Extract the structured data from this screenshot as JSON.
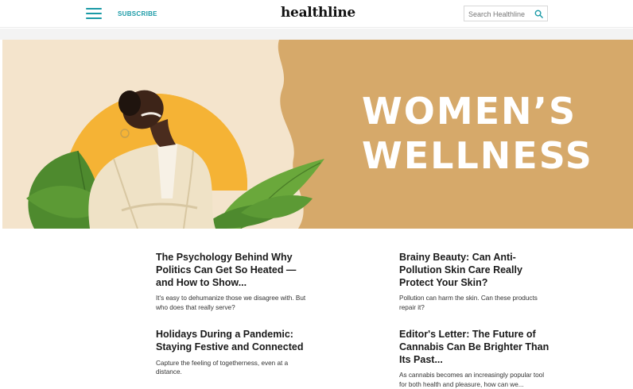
{
  "header": {
    "subscribe_label": "SUBSCRIBE",
    "logo_text": "healthline",
    "search_placeholder": "Search Healthline",
    "accent_color": "#1a9aa6"
  },
  "hero": {
    "title_line1": "WOMEN’S",
    "title_line2": "WELLNESS",
    "background_color": "#d6a96a"
  },
  "articles": [
    {
      "title": "The Psychology Behind Why Politics Can Get So Heated — and How to Show...",
      "summary": "It's easy to dehumanize those we disagree with. But who does that really serve?"
    },
    {
      "title": "Brainy Beauty: Can Anti-Pollution Skin Care Really Protect Your Skin?",
      "summary": "Pollution can harm the skin. Can these products repair it?"
    },
    {
      "title": "Holidays During a Pandemic: Staying Festive and Connected",
      "summary": "Capture the feeling of togetherness, even at a distance."
    },
    {
      "title": "Editor's Letter: The Future of Cannabis Can Be Brighter Than Its Past...",
      "summary": "As cannabis becomes an increasingly popular tool for both health and pleasure, how can we..."
    }
  ]
}
